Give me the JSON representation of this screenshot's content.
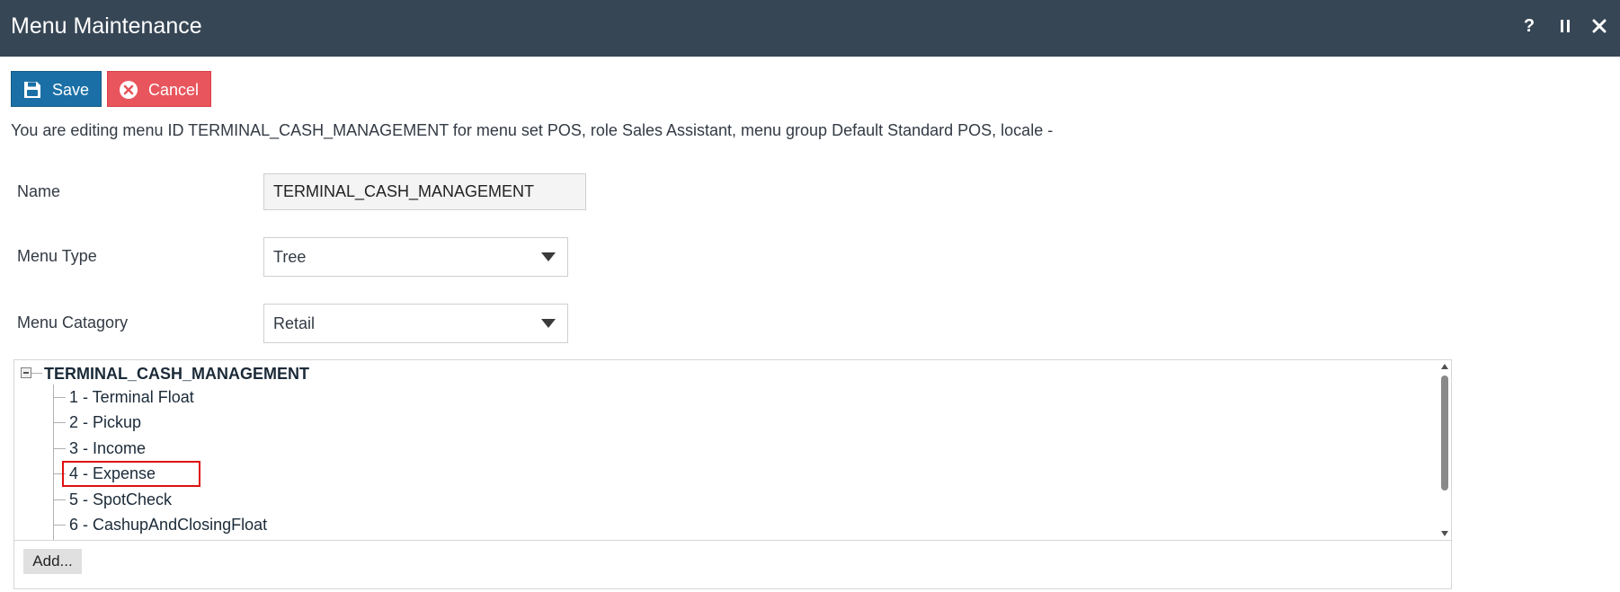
{
  "window": {
    "title": "Menu Maintenance",
    "controls": {
      "help_label": "?",
      "help_icon": "question-mark-icon",
      "pause_icon": "pause-icon",
      "close_icon": "close-icon"
    }
  },
  "toolbar": {
    "save_label": "Save",
    "save_icon": "floppy-disk-icon",
    "cancel_label": "Cancel",
    "cancel_icon": "circle-x-icon"
  },
  "info_text": "You are editing menu ID TERMINAL_CASH_MANAGEMENT for menu set POS, role Sales Assistant, menu group Default Standard POS, locale -",
  "form": {
    "name": {
      "label": "Name",
      "value": "TERMINAL_CASH_MANAGEMENT"
    },
    "menu_type": {
      "label": "Menu Type",
      "value": "Tree"
    },
    "menu_category": {
      "label": "Menu Catagory",
      "value": "Retail"
    }
  },
  "tree": {
    "root_label": "TERMINAL_CASH_MANAGEMENT",
    "nodes": [
      {
        "label": "1 - Terminal Float"
      },
      {
        "label": "2 - Pickup"
      },
      {
        "label": "3 - Income"
      },
      {
        "label": "4 - Expense"
      },
      {
        "label": "5 - SpotCheck"
      },
      {
        "label": "6 - CashupAndClosingFloat"
      }
    ],
    "highlighted_node_index": 3,
    "add_label": "Add..."
  },
  "colors": {
    "titlebar_bg": "#374655",
    "save_bg": "#1a70a6",
    "cancel_bg": "#e8555d",
    "highlight_border": "#e01010"
  }
}
